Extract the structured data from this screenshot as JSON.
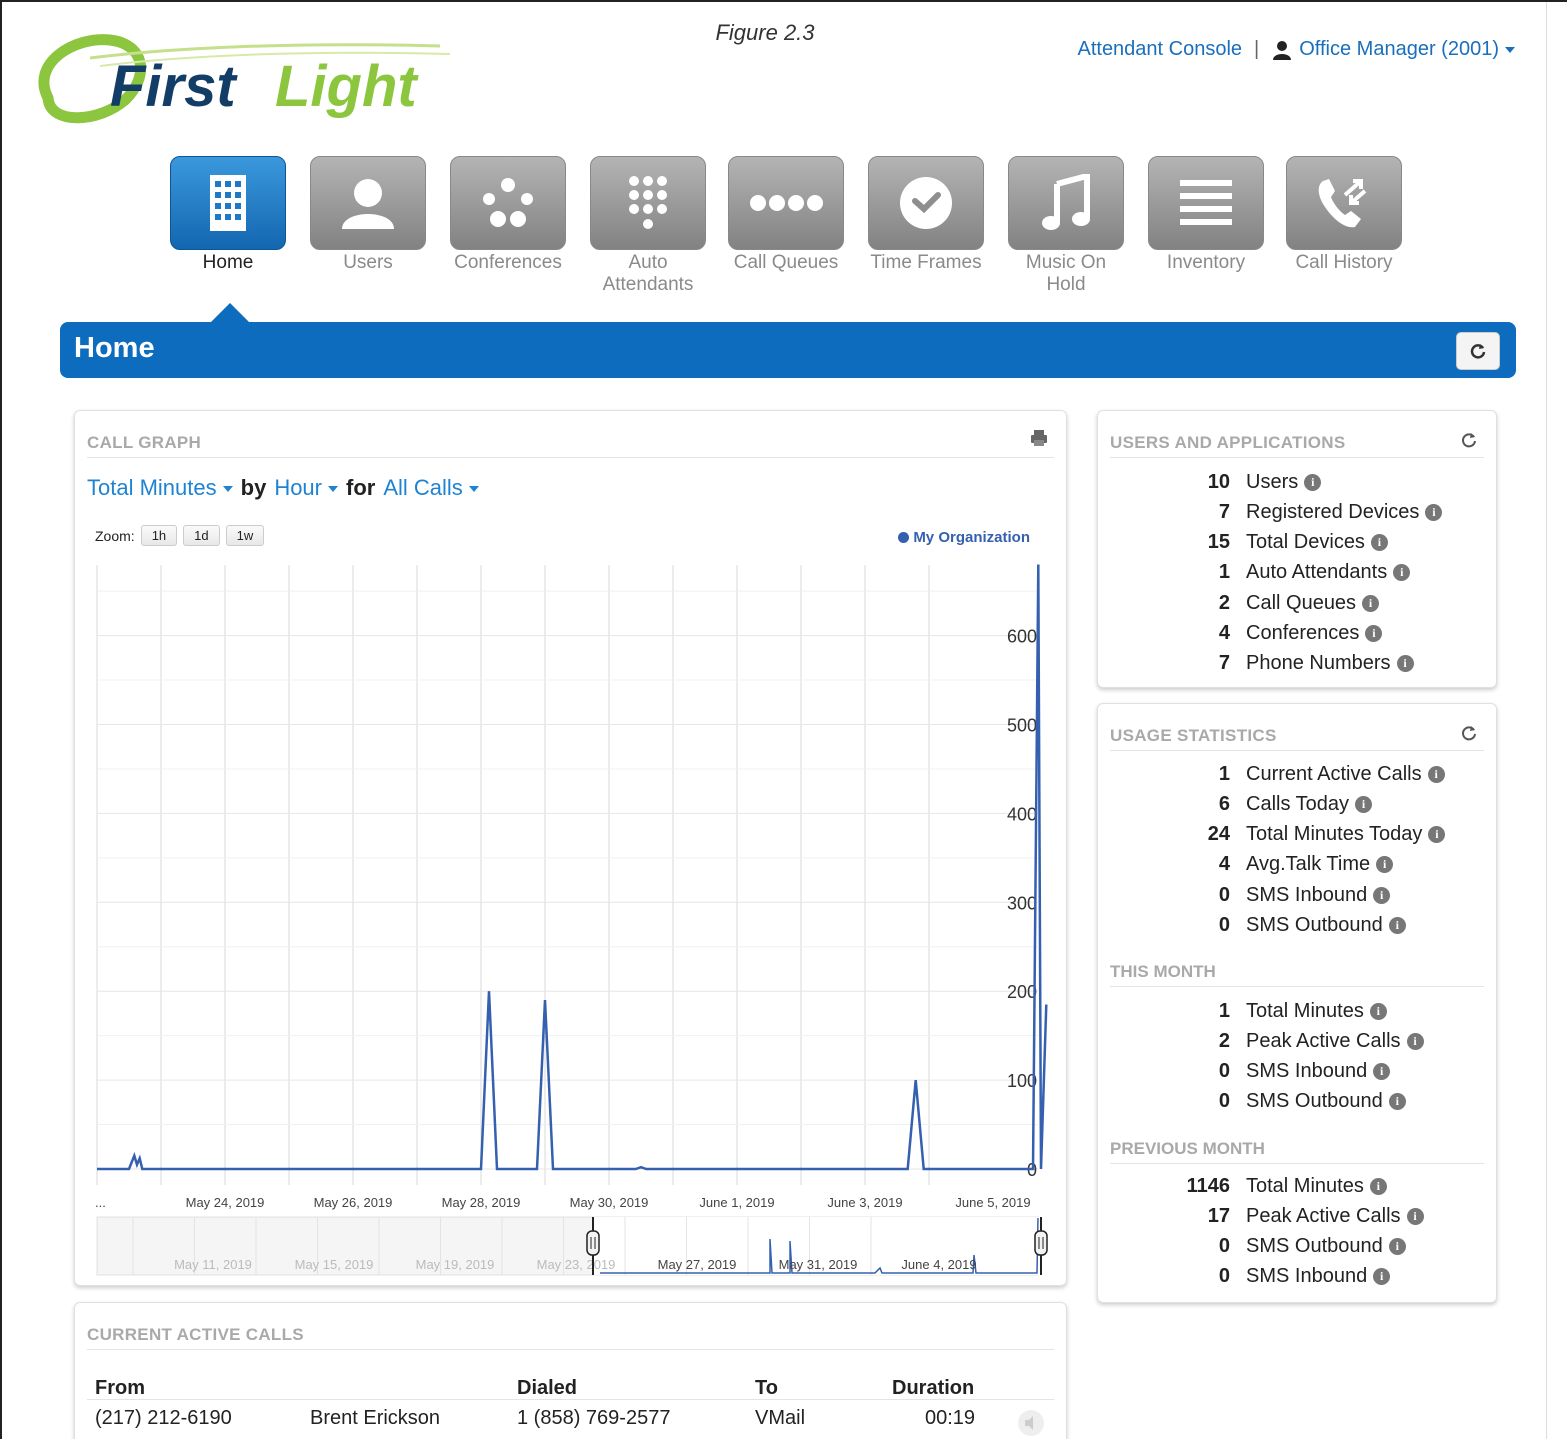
{
  "caption": "Figure 2.3",
  "logo": {
    "text": "FirstLight"
  },
  "top_links": {
    "attendant_console": "Attendant Console",
    "separator": "|",
    "user_menu": "Office Manager (2001)"
  },
  "nav": [
    {
      "label": "Home",
      "icon": "building-icon",
      "active": true
    },
    {
      "label": "Users",
      "icon": "user-icon"
    },
    {
      "label": "Conferences",
      "icon": "conference-icon"
    },
    {
      "label": "Auto Attendants",
      "icon": "keypad-icon"
    },
    {
      "label": "Call Queues",
      "icon": "queue-dots-icon"
    },
    {
      "label": "Time Frames",
      "icon": "clock-icon"
    },
    {
      "label": "Music On Hold",
      "icon": "music-note-icon"
    },
    {
      "label": "Inventory",
      "icon": "list-lines-icon"
    },
    {
      "label": "Call History",
      "icon": "phone-arrows-icon"
    }
  ],
  "page_title": "Home",
  "call_graph": {
    "title": "CALL GRAPH",
    "metric": "Total Minutes",
    "by_word": "by",
    "interval": "Hour",
    "for_word": "for",
    "filter": "All Calls",
    "zoom_label": "Zoom:",
    "zoom_options": [
      "1h",
      "1d",
      "1w"
    ],
    "legend": "My Organization",
    "ellipsis": "..."
  },
  "chart_data": {
    "type": "line",
    "series": [
      {
        "name": "My Organization",
        "points": [
          [
            "2019-05-22T12",
            0
          ],
          [
            "2019-05-22T14",
            15
          ],
          [
            "2019-05-22T15",
            5
          ],
          [
            "2019-05-22T16",
            12
          ],
          [
            "2019-05-22T17",
            0
          ],
          [
            "2019-05-28T00",
            0
          ],
          [
            "2019-05-28T03",
            200
          ],
          [
            "2019-05-28T06",
            0
          ],
          [
            "2019-05-28T21",
            0
          ],
          [
            "2019-05-29T00",
            190
          ],
          [
            "2019-05-29T03",
            0
          ],
          [
            "2019-05-30T10",
            0
          ],
          [
            "2019-05-30T12",
            2
          ],
          [
            "2019-05-30T14",
            0
          ],
          [
            "2019-06-03T16",
            0
          ],
          [
            "2019-06-03T19",
            100
          ],
          [
            "2019-06-03T22",
            0
          ],
          [
            "2019-06-05T15",
            0
          ],
          [
            "2019-06-05T17",
            680
          ],
          [
            "2019-06-05T18",
            0
          ],
          [
            "2019-06-05T20",
            185
          ]
        ]
      }
    ],
    "x_ticks": [
      "May 24, 2019",
      "May 26, 2019",
      "May 28, 2019",
      "May 30, 2019",
      "June 1, 2019",
      "June 3, 2019",
      "June 5, 2019"
    ],
    "y_ticks": [
      "0",
      "100",
      "200",
      "300",
      "400",
      "500",
      "600"
    ],
    "ylim": [
      0,
      700
    ],
    "grid": true,
    "navigator_ticks": [
      "May 11, 2019",
      "May 15, 2019",
      "May 19, 2019",
      "May 23, 2019",
      "May 27, 2019",
      "May 31, 2019",
      "June 4, 2019"
    ]
  },
  "users_apps": {
    "title": "USERS AND APPLICATIONS",
    "rows": [
      {
        "num": "10",
        "label": "Users"
      },
      {
        "num": "7",
        "label": "Registered Devices"
      },
      {
        "num": "15",
        "label": "Total Devices"
      },
      {
        "num": "1",
        "label": "Auto Attendants"
      },
      {
        "num": "2",
        "label": "Call Queues"
      },
      {
        "num": "4",
        "label": "Conferences"
      },
      {
        "num": "7",
        "label": "Phone Numbers"
      }
    ]
  },
  "usage": {
    "title": "USAGE STATISTICS",
    "rows": [
      {
        "num": "1",
        "label": "Current Active Calls"
      },
      {
        "num": "6",
        "label": "Calls Today"
      },
      {
        "num": "24",
        "label": "Total Minutes Today"
      },
      {
        "num": "4",
        "label": "Avg.Talk Time"
      },
      {
        "num": "0",
        "label": "SMS Inbound"
      },
      {
        "num": "0",
        "label": "SMS Outbound"
      }
    ],
    "this_month_title": "THIS MONTH",
    "this_month": [
      {
        "num": "1",
        "label": "Total Minutes"
      },
      {
        "num": "2",
        "label": "Peak Active Calls"
      },
      {
        "num": "0",
        "label": "SMS Inbound"
      },
      {
        "num": "0",
        "label": "SMS Outbound"
      }
    ],
    "prev_month_title": "PREVIOUS MONTH",
    "prev_month": [
      {
        "num": "1146",
        "label": "Total Minutes"
      },
      {
        "num": "17",
        "label": "Peak Active Calls"
      },
      {
        "num": "0",
        "label": "SMS Outbound"
      },
      {
        "num": "0",
        "label": "SMS Inbound"
      }
    ]
  },
  "active_calls": {
    "title": "CURRENT ACTIVE CALLS",
    "headers": [
      "From",
      "Dialed",
      "To",
      "Duration"
    ],
    "rows": [
      {
        "from_num": "(217) 212-6190",
        "from_name": "Brent Erickson",
        "dialed": "1 (858) 769-2577",
        "to": "VMail",
        "duration": "00:19"
      }
    ]
  }
}
